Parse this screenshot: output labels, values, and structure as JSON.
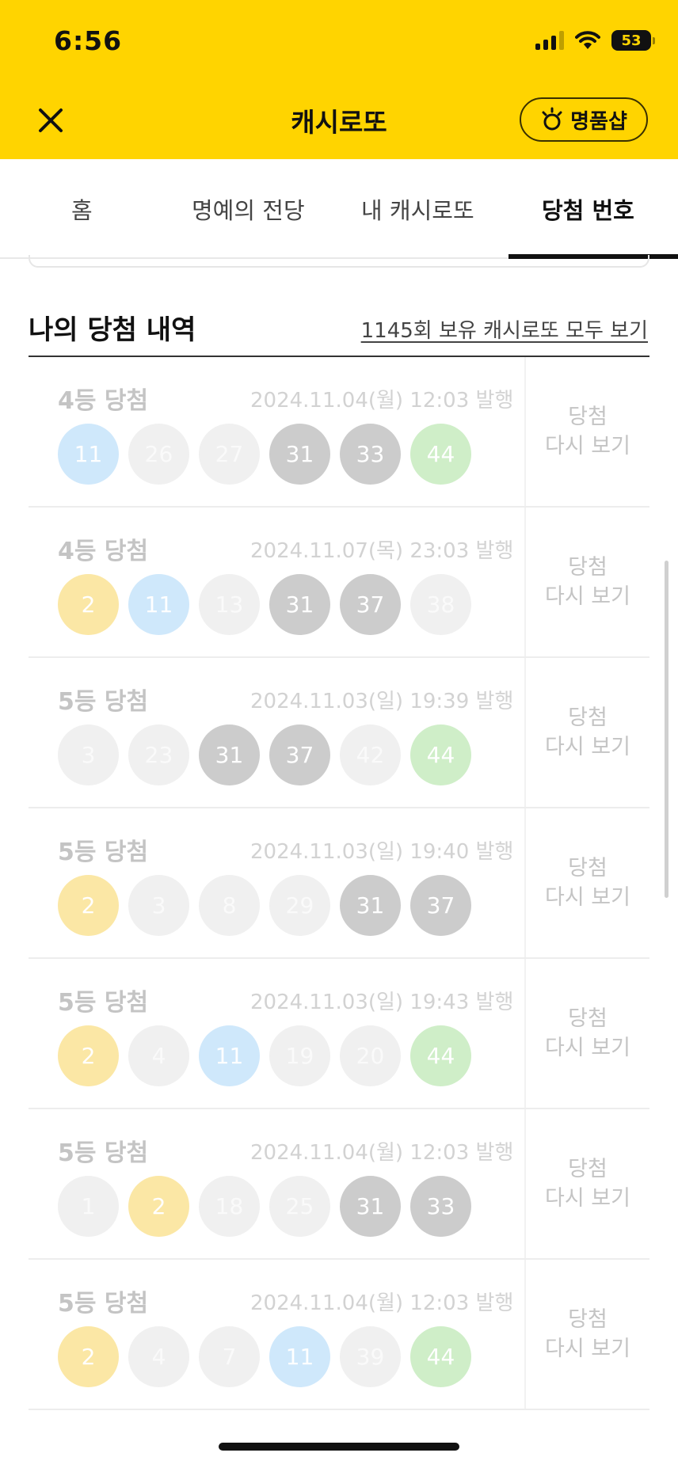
{
  "status_bar": {
    "time": "6:56",
    "battery": "53"
  },
  "header": {
    "title": "캐시로또",
    "shop_label": "명품샵"
  },
  "tabs": [
    {
      "label": "홈"
    },
    {
      "label": "명예의 전당"
    },
    {
      "label": "내 캐시로또"
    },
    {
      "label": "당첨 번호",
      "active": true
    }
  ],
  "section": {
    "title": "나의 당첨 내역",
    "link": "1145회 보유 캐시로또 모두 보기"
  },
  "recheck_label": {
    "line1": "당첨",
    "line2": "다시 보기"
  },
  "ball_colors": {
    "yellow": "#fbe7a5",
    "blue": "#cfe8fb",
    "gray": "#cccccc",
    "green": "#cfeec8",
    "light": "#f0f0f0"
  },
  "rows": [
    {
      "rank": "4등 당첨",
      "date": "2024.11.04(월) 12:03 발행",
      "balls": [
        {
          "n": "11",
          "c": "blue"
        },
        {
          "n": "26",
          "c": "light"
        },
        {
          "n": "27",
          "c": "light"
        },
        {
          "n": "31",
          "c": "gray"
        },
        {
          "n": "33",
          "c": "gray"
        },
        {
          "n": "44",
          "c": "green"
        }
      ]
    },
    {
      "rank": "4등 당첨",
      "date": "2024.11.07(목) 23:03 발행",
      "balls": [
        {
          "n": "2",
          "c": "yellow"
        },
        {
          "n": "11",
          "c": "blue"
        },
        {
          "n": "13",
          "c": "light"
        },
        {
          "n": "31",
          "c": "gray"
        },
        {
          "n": "37",
          "c": "gray"
        },
        {
          "n": "38",
          "c": "light"
        }
      ]
    },
    {
      "rank": "5등 당첨",
      "date": "2024.11.03(일) 19:39 발행",
      "balls": [
        {
          "n": "3",
          "c": "light"
        },
        {
          "n": "23",
          "c": "light"
        },
        {
          "n": "31",
          "c": "gray"
        },
        {
          "n": "37",
          "c": "gray"
        },
        {
          "n": "42",
          "c": "light"
        },
        {
          "n": "44",
          "c": "green"
        }
      ]
    },
    {
      "rank": "5등 당첨",
      "date": "2024.11.03(일) 19:40 발행",
      "balls": [
        {
          "n": "2",
          "c": "yellow"
        },
        {
          "n": "3",
          "c": "light"
        },
        {
          "n": "8",
          "c": "light"
        },
        {
          "n": "29",
          "c": "light"
        },
        {
          "n": "31",
          "c": "gray"
        },
        {
          "n": "37",
          "c": "gray"
        }
      ]
    },
    {
      "rank": "5등 당첨",
      "date": "2024.11.03(일) 19:43 발행",
      "balls": [
        {
          "n": "2",
          "c": "yellow"
        },
        {
          "n": "4",
          "c": "light"
        },
        {
          "n": "11",
          "c": "blue"
        },
        {
          "n": "19",
          "c": "light"
        },
        {
          "n": "20",
          "c": "light"
        },
        {
          "n": "44",
          "c": "green"
        }
      ]
    },
    {
      "rank": "5등 당첨",
      "date": "2024.11.04(월) 12:03 발행",
      "balls": [
        {
          "n": "1",
          "c": "light"
        },
        {
          "n": "2",
          "c": "yellow"
        },
        {
          "n": "18",
          "c": "light"
        },
        {
          "n": "25",
          "c": "light"
        },
        {
          "n": "31",
          "c": "gray"
        },
        {
          "n": "33",
          "c": "gray"
        }
      ]
    },
    {
      "rank": "5등 당첨",
      "date": "2024.11.04(월) 12:03 발행",
      "balls": [
        {
          "n": "2",
          "c": "yellow"
        },
        {
          "n": "4",
          "c": "light"
        },
        {
          "n": "7",
          "c": "light"
        },
        {
          "n": "11",
          "c": "blue"
        },
        {
          "n": "39",
          "c": "light"
        },
        {
          "n": "44",
          "c": "green"
        }
      ]
    }
  ]
}
